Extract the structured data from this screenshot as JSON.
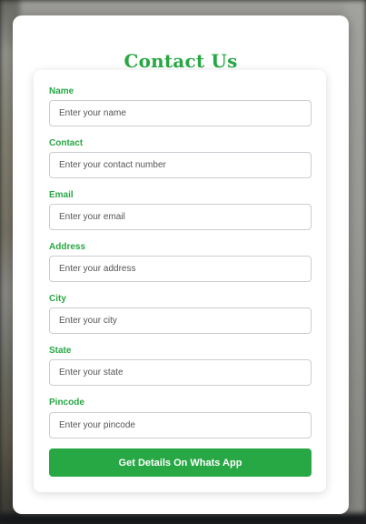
{
  "modal": {
    "title": "Contact Us",
    "fields": [
      {
        "label": "Name",
        "placeholder": "Enter your name",
        "value": ""
      },
      {
        "label": "Contact",
        "placeholder": "Enter your contact number",
        "value": ""
      },
      {
        "label": "Email",
        "placeholder": "Enter your email",
        "value": ""
      },
      {
        "label": "Address",
        "placeholder": "Enter your address",
        "value": ""
      },
      {
        "label": "City",
        "placeholder": "Enter your city",
        "value": ""
      },
      {
        "label": "State",
        "placeholder": "Enter your state",
        "value": ""
      },
      {
        "label": "Pincode",
        "placeholder": "Enter your pincode",
        "value": ""
      }
    ],
    "submit_label": "Get Details On Whats App"
  },
  "colors": {
    "accent": "#28a745",
    "input_border": "#c9cdd2",
    "placeholder": "#555555",
    "modal_bg": "#ffffff"
  }
}
